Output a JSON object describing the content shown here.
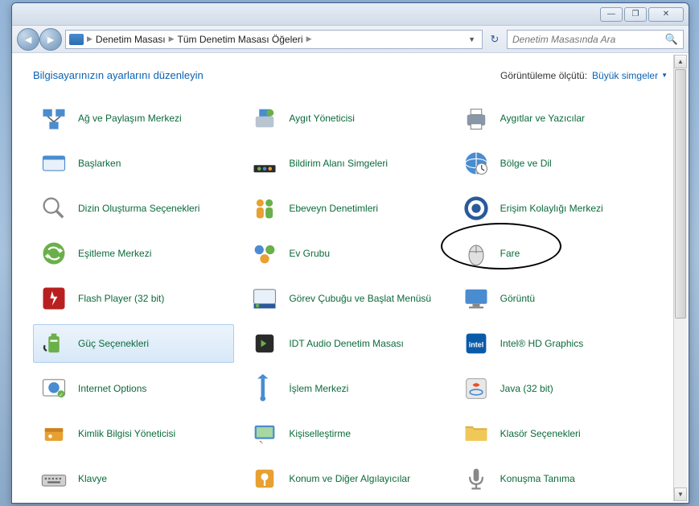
{
  "window": {
    "min_icon": "—",
    "max_icon": "❐",
    "close_icon": "✕"
  },
  "addressbar": {
    "crumb1": "Denetim Masası",
    "crumb2": "Tüm Denetim Masası Öğeleri",
    "search_placeholder": "Denetim Masasında Ara"
  },
  "heading": "Bilgisayarınızın ayarlarını düzenleyin",
  "viewby": {
    "label": "Görüntüleme ölçütü:",
    "value": "Büyük simgeler"
  },
  "items": [
    {
      "label": "Ağ ve Paylaşım Merkezi",
      "icon": "network",
      "selected": false,
      "circled": false
    },
    {
      "label": "Aygıt Yöneticisi",
      "icon": "device-mgr",
      "selected": false,
      "circled": false
    },
    {
      "label": "Aygıtlar ve Yazıcılar",
      "icon": "printers",
      "selected": false,
      "circled": false
    },
    {
      "label": "Başlarken",
      "icon": "getting-started",
      "selected": false,
      "circled": false
    },
    {
      "label": "Bildirim Alanı Simgeleri",
      "icon": "tray",
      "selected": false,
      "circled": false
    },
    {
      "label": "Bölge ve Dil",
      "icon": "region",
      "selected": false,
      "circled": false
    },
    {
      "label": "Dizin Oluşturma Seçenekleri",
      "icon": "indexing",
      "selected": false,
      "circled": false
    },
    {
      "label": "Ebeveyn Denetimleri",
      "icon": "parental",
      "selected": false,
      "circled": false
    },
    {
      "label": "Erişim Kolaylığı Merkezi",
      "icon": "ease",
      "selected": false,
      "circled": false
    },
    {
      "label": "Eşitleme Merkezi",
      "icon": "sync",
      "selected": false,
      "circled": false
    },
    {
      "label": "Ev Grubu",
      "icon": "homegroup",
      "selected": false,
      "circled": false
    },
    {
      "label": "Fare",
      "icon": "mouse",
      "selected": false,
      "circled": true
    },
    {
      "label": "Flash Player (32 bit)",
      "icon": "flash",
      "selected": false,
      "circled": false
    },
    {
      "label": "Görev Çubuğu ve Başlat Menüsü",
      "icon": "taskbar",
      "selected": false,
      "circled": false
    },
    {
      "label": "Görüntü",
      "icon": "display",
      "selected": false,
      "circled": false
    },
    {
      "label": "Güç Seçenekleri",
      "icon": "power",
      "selected": true,
      "circled": false
    },
    {
      "label": "IDT Audio Denetim Masası",
      "icon": "idt",
      "selected": false,
      "circled": false
    },
    {
      "label": "Intel® HD Graphics",
      "icon": "intel",
      "selected": false,
      "circled": false
    },
    {
      "label": "Internet Options",
      "icon": "internet",
      "selected": false,
      "circled": false
    },
    {
      "label": "İşlem Merkezi",
      "icon": "action",
      "selected": false,
      "circled": false
    },
    {
      "label": "Java (32 bit)",
      "icon": "java",
      "selected": false,
      "circled": false
    },
    {
      "label": "Kimlik Bilgisi Yöneticisi",
      "icon": "credential",
      "selected": false,
      "circled": false
    },
    {
      "label": "Kişiselleştirme",
      "icon": "personalize",
      "selected": false,
      "circled": false
    },
    {
      "label": "Klasör Seçenekleri",
      "icon": "folder",
      "selected": false,
      "circled": false
    },
    {
      "label": "Klavye",
      "icon": "keyboard",
      "selected": false,
      "circled": false
    },
    {
      "label": "Konum ve Diğer Algılayıcılar",
      "icon": "location",
      "selected": false,
      "circled": false
    },
    {
      "label": "Konuşma Tanıma",
      "icon": "speech",
      "selected": false,
      "circled": false
    }
  ]
}
